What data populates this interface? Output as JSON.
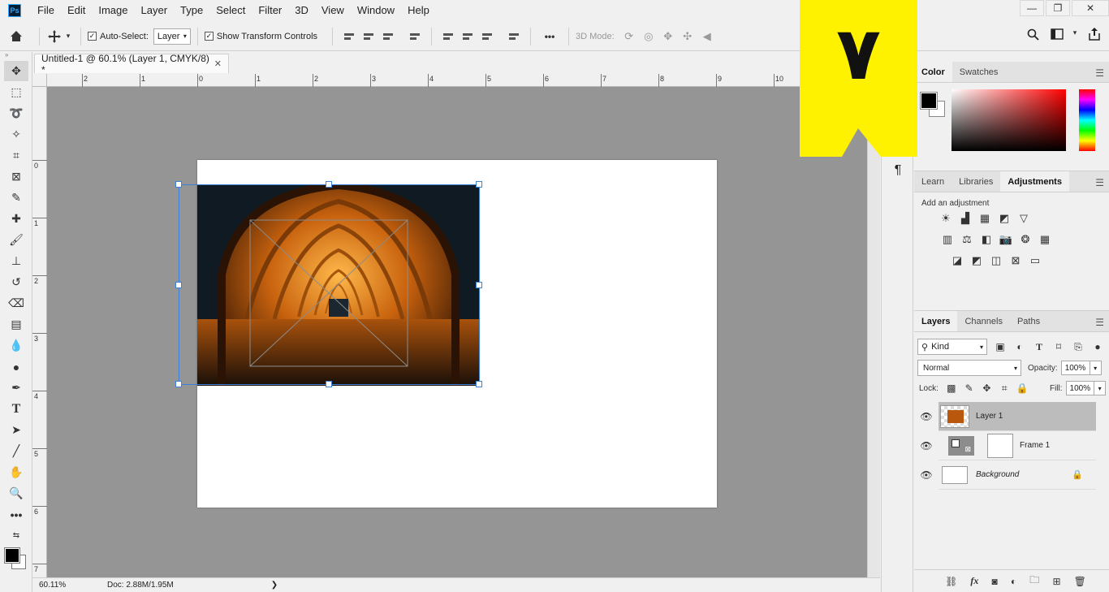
{
  "menubar": {
    "logo": "Ps",
    "items": [
      "File",
      "Edit",
      "Image",
      "Layer",
      "Type",
      "Select",
      "Filter",
      "3D",
      "View",
      "Window",
      "Help"
    ]
  },
  "options": {
    "auto_select_label": "Auto-Select:",
    "auto_select_target": "Layer",
    "show_transform_label": "Show Transform Controls",
    "more_label": "•••",
    "mode_3d_label": "3D Mode:"
  },
  "document": {
    "tab_title": "Untitled-1 @ 60.1% (Layer 1, CMYK/8) *",
    "zoom": "60.11%",
    "doc_info": "Doc: 2.88M/1.95M"
  },
  "rulers": {
    "h_labels": [
      "2",
      "1",
      "0",
      "1",
      "2",
      "3",
      "4",
      "5",
      "6",
      "7",
      "8",
      "9",
      "10"
    ],
    "v_labels": [
      "0",
      "1",
      "2",
      "3",
      "4",
      "5",
      "6",
      "7"
    ]
  },
  "color_panel": {
    "tabs": [
      "Color",
      "Swatches"
    ],
    "active_tab": "Color",
    "foreground": "#000000",
    "background": "#ffffff"
  },
  "adjustments_panel": {
    "tabs": [
      "Learn",
      "Libraries",
      "Adjustments"
    ],
    "active_tab": "Adjustments",
    "add_label": "Add an adjustment"
  },
  "layers_panel": {
    "tabs": [
      "Layers",
      "Channels",
      "Paths"
    ],
    "active_tab": "Layers",
    "kind_label": "Kind",
    "blend_mode": "Normal",
    "opacity_label": "Opacity:",
    "opacity": "100%",
    "lock_label": "Lock:",
    "fill_label": "Fill:",
    "fill": "100%",
    "layers": [
      {
        "name": "Layer 1",
        "selected": true
      },
      {
        "name": "Frame 1",
        "selected": false
      },
      {
        "name": "Background",
        "selected": false
      }
    ],
    "footer_fx": "fx"
  },
  "badge": {
    "text": "۷",
    "color": "#fff200"
  }
}
